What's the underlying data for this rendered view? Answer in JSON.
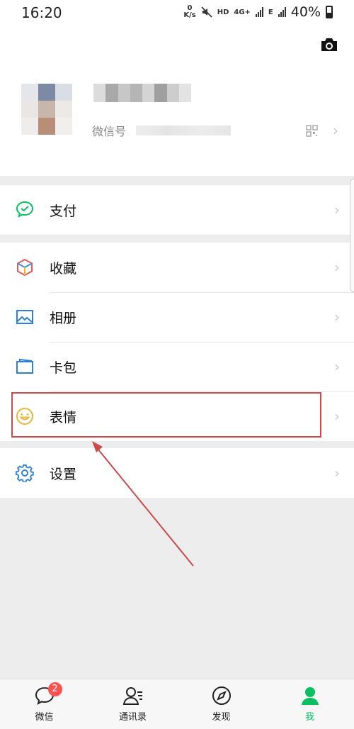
{
  "status_bar": {
    "time": "16:20",
    "net_speed_value": "0",
    "net_speed_unit": "K/s",
    "hd": "HD",
    "network": "4G+",
    "network2": "E",
    "battery": "40%"
  },
  "profile": {
    "wechat_id_label": "微信号"
  },
  "menu": {
    "pay": "支付",
    "favorites": "收藏",
    "album": "相册",
    "cards": "卡包",
    "stickers": "表情",
    "settings": "设置"
  },
  "bottom_nav": {
    "chats": "微信",
    "chats_badge": "2",
    "contacts": "通讯录",
    "discover": "发现",
    "me": "我"
  },
  "colors": {
    "brand_green": "#07c160",
    "badge_red": "#fa5151",
    "highlight_red": "#c94b4b"
  }
}
